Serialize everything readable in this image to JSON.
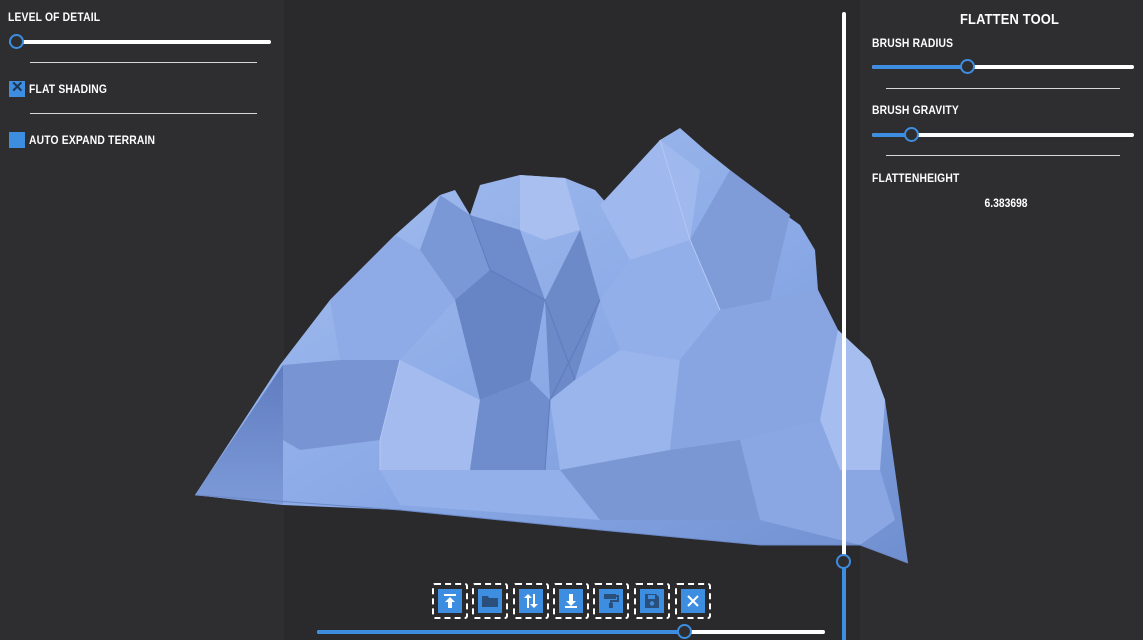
{
  "left_panel": {
    "level_of_detail_label": "LEVEL OF DETAIL",
    "level_of_detail_value": 0.0,
    "flat_shading_label": "FLAT SHADING",
    "flat_shading_checked": true,
    "auto_expand_label": "AUTO EXPAND TERRAIN",
    "auto_expand_checked": false
  },
  "right_panel": {
    "title": "FLATTEN TOOL",
    "brush_radius_label": "BRUSH RADIUS",
    "brush_radius_value": 0.36,
    "brush_gravity_label": "BRUSH GRAVITY",
    "brush_gravity_value": 0.15,
    "flatten_height_label": "FLATTENHEIGHT",
    "flatten_height_value": "6.383698"
  },
  "vertical_slider_value": 0.14,
  "bottom_slider_value": 0.73,
  "toolbar": [
    {
      "icon": "upload-icon"
    },
    {
      "icon": "folder-icon"
    },
    {
      "icon": "swap-vertical-icon"
    },
    {
      "icon": "download-icon"
    },
    {
      "icon": "paint-roller-icon"
    },
    {
      "icon": "save-icon"
    },
    {
      "icon": "close-icon"
    }
  ],
  "colors": {
    "accent": "#3d8ee0",
    "terrain": "#8aa9e6",
    "background": "#2a2a2c"
  }
}
